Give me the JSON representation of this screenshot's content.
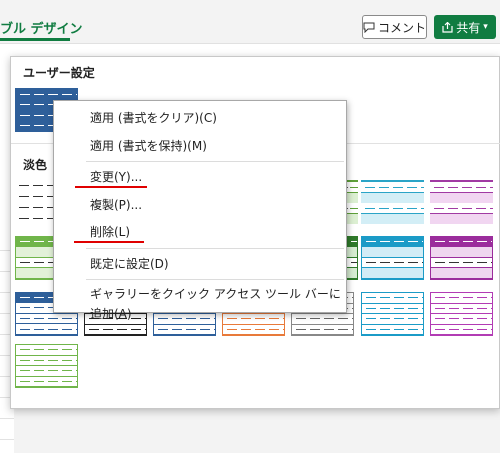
{
  "ribbon": {
    "active_tab": "ブル デザイン",
    "comment_label": "コメント",
    "share_label": "共有"
  },
  "panel": {
    "custom_heading": "ユーザー設定",
    "light_heading": "淡色"
  },
  "menu": {
    "items": [
      "適用 (書式をクリア)(C)",
      "適用 (書式を保持)(M)",
      "変更(Y)...",
      "複製(P)...",
      "削除(L)",
      "既定に設定(D)",
      "ギャラリーをクイック アクセス ツール バーに追加(A)"
    ]
  },
  "colors": {
    "accent": "#107c41",
    "highlight_underline": "#e00000"
  },
  "icons": [
    "comment-icon",
    "share-icon",
    "chevron-down-icon"
  ]
}
